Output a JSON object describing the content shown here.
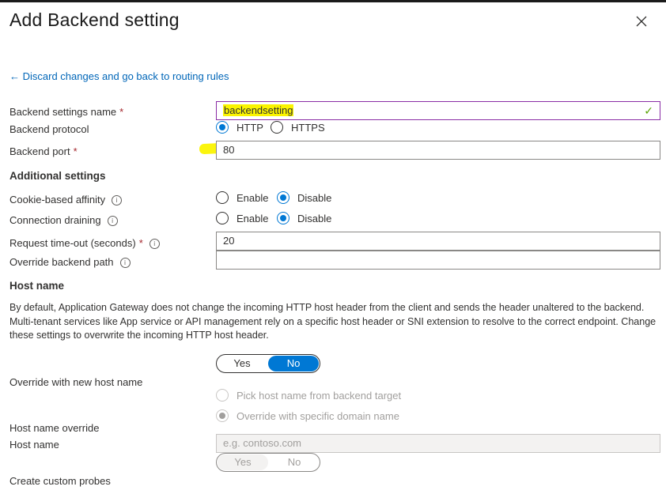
{
  "panel": {
    "title": "Add Backend setting",
    "back_link": "← Discard changes and go back to routing rules"
  },
  "fields": {
    "backend_settings_name": {
      "label": "Backend settings name",
      "required": "*",
      "value": "backendsetting"
    },
    "backend_protocol": {
      "label": "Backend protocol",
      "options": [
        "HTTP",
        "HTTPS"
      ],
      "selected": "HTTP"
    },
    "backend_port": {
      "label": "Backend port",
      "required": "*",
      "value": "80"
    }
  },
  "additional": {
    "heading": "Additional settings",
    "cookie_affinity": {
      "label": "Cookie-based affinity",
      "options": [
        "Enable",
        "Disable"
      ],
      "selected": "Disable"
    },
    "connection_draining": {
      "label": "Connection draining",
      "options": [
        "Enable",
        "Disable"
      ],
      "selected": "Disable"
    },
    "request_timeout": {
      "label": "Request time-out (seconds)",
      "required": "*",
      "value": "20"
    },
    "override_path": {
      "label": "Override backend path",
      "value": ""
    }
  },
  "host": {
    "heading": "Host name",
    "description": "By default, Application Gateway does not change the incoming HTTP host header from the client and sends the header unaltered to the backend. Multi-tenant services like App service or API management rely on a specific host header or SNI extension to resolve to the correct endpoint. Change these settings to overwrite the incoming HTTP host header.",
    "override_new": {
      "label": "Override with new host name",
      "options": [
        "Yes",
        "No"
      ],
      "selected": "No"
    },
    "pick_from_backend": "Pick host name from backend target",
    "override_specific": "Override with specific domain name",
    "host_name_override_label": "Host name override",
    "host_name": {
      "label": "Host name",
      "placeholder": "e.g. contoso.com"
    },
    "custom_probes": {
      "label": "Create custom probes",
      "options": [
        "Yes",
        "No"
      ]
    }
  },
  "icons": {
    "close": "close-icon",
    "info": "info-icon",
    "check": "checkmark-icon"
  },
  "colors": {
    "accent": "#0078d4",
    "link": "#0066b8",
    "highlight": "#fbf400",
    "focus_border": "#8a2da5",
    "valid": "#57a300"
  }
}
